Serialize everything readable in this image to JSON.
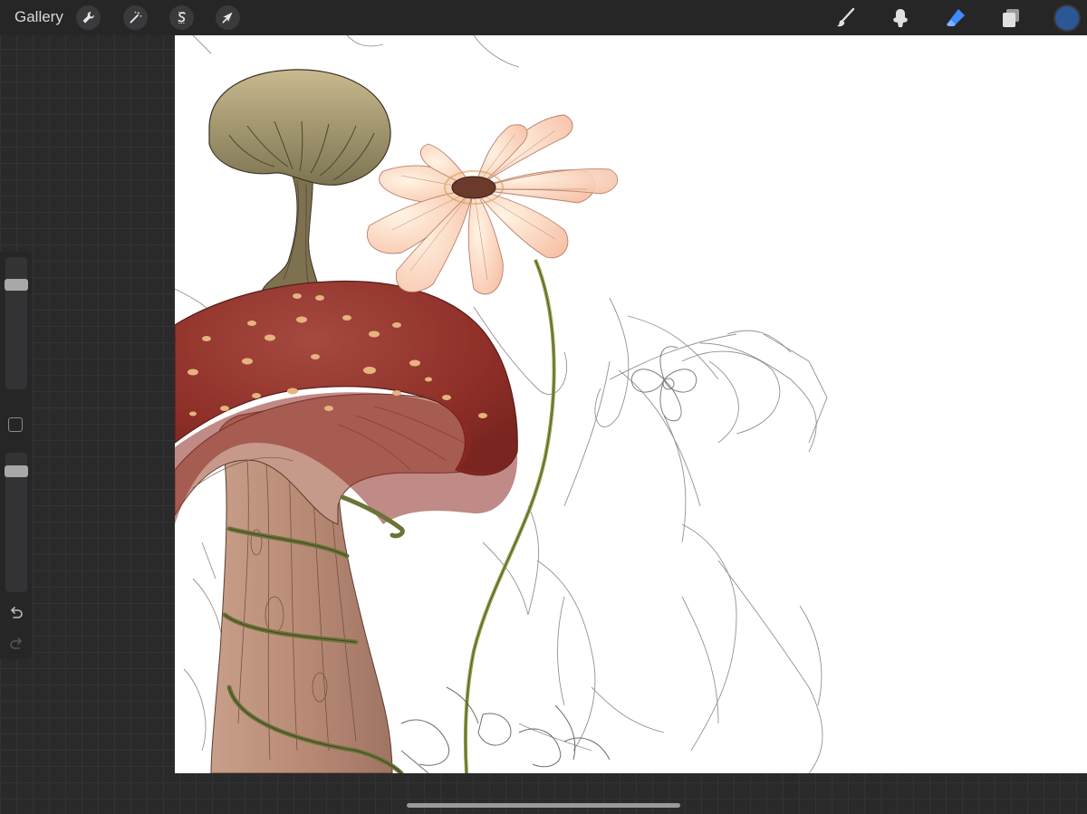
{
  "toolbar": {
    "gallery_label": "Gallery",
    "left_tools": [
      {
        "name": "actions",
        "icon": "wrench-icon"
      },
      {
        "name": "adjustments",
        "icon": "magic-wand-icon"
      },
      {
        "name": "selection",
        "icon": "selection-s-icon"
      },
      {
        "name": "transform",
        "icon": "arrow-cursor-icon"
      }
    ],
    "right_tools": [
      {
        "name": "brush",
        "icon": "brush-icon",
        "active": false
      },
      {
        "name": "smudge",
        "icon": "smudge-icon",
        "active": false
      },
      {
        "name": "eraser",
        "icon": "eraser-icon",
        "active": true
      },
      {
        "name": "layers",
        "icon": "layers-icon",
        "active": false
      }
    ],
    "current_color": "#2b5797",
    "active_tool_color": "#3d8bfd"
  },
  "sidebar": {
    "brush_size_level": 0.82,
    "opacity_level": 0.9,
    "icons": [
      "modifier-square-icon",
      "undo-icon",
      "redo-icon"
    ]
  },
  "canvas": {
    "artwork": "mushroom-and-flower-illustration"
  }
}
